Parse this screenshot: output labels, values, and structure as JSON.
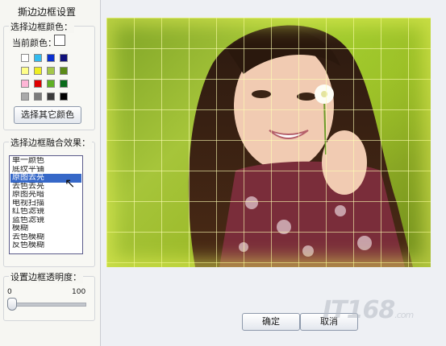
{
  "title": "撕边边框设置",
  "color_group": {
    "label": "选择边框颜色：",
    "current_label": "当前颜色：",
    "current_color": "#ffffff",
    "swatches": [
      "#ffffff",
      "#33bbee",
      "#0a2fd0",
      "#10107a",
      "#ffff88",
      "#eeee22",
      "#a5c84a",
      "#5b8a17",
      "#ffb6d6",
      "#e00000",
      "#5fb024",
      "#0a6b1a",
      "#aaaaaa",
      "#7b7b7b",
      "#3b3b3b",
      "#000000"
    ],
    "other_button": "选择其它颜色"
  },
  "blend_group": {
    "label": "选择边框融合效果：",
    "options": [
      "单一颜色",
      "底纹平铺",
      "原图去亮",
      "去色去亮",
      "原图亮暗",
      "电视扫描",
      "红色滤镜",
      "蓝色滤镜",
      "模糊",
      "去色模糊",
      "反色模糊"
    ],
    "selected_index": 2
  },
  "opacity_group": {
    "label": "设置边框透明度：",
    "min": "0",
    "max": "100",
    "value": 0
  },
  "buttons": {
    "ok": "确定",
    "cancel": "取消"
  },
  "watermark": {
    "brand": "IT168",
    "suffix": ".com"
  }
}
